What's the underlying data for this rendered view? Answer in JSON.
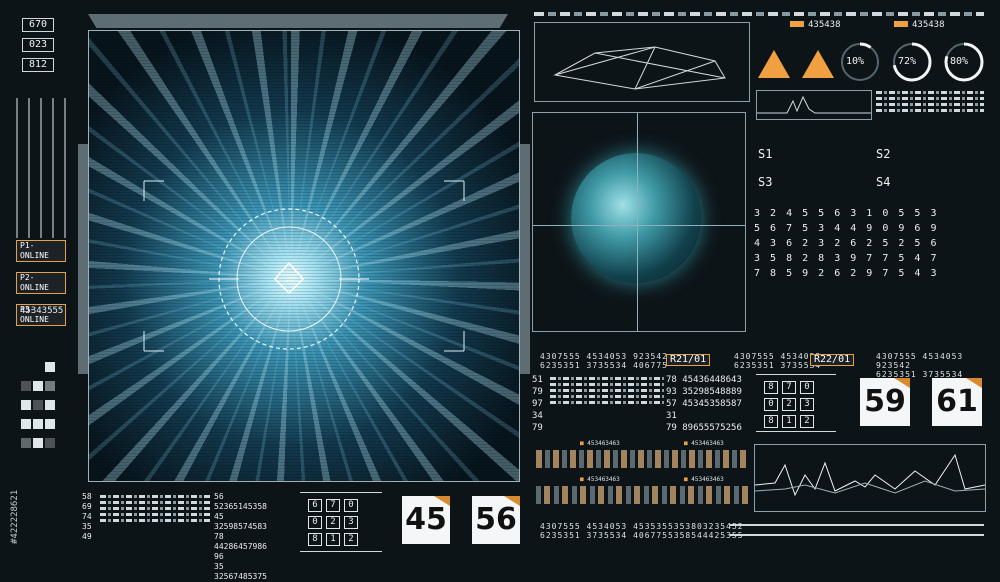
{
  "left_column": {
    "top_boxes": [
      "670",
      "023",
      "812"
    ],
    "status_labels": [
      "P1-ONLINE",
      "P2-ONLINE",
      "P3-ONLINE"
    ],
    "number": "45343555"
  },
  "watermark_id": "#422228621",
  "bottom_left_numbers": {
    "left": [
      "58",
      "69",
      "74",
      "35",
      "49"
    ],
    "mid_left": [
      "58",
      "45",
      "78",
      "96",
      "35"
    ],
    "mid_right": [
      "56 52365145358",
      "45 32598574583",
      "78 44286457986",
      "96 ",
      "35 32567485375"
    ]
  },
  "bottom_left_grid": [
    "6",
    "7",
    "0",
    "0",
    "2",
    "3",
    "8",
    "1",
    "2"
  ],
  "cards": {
    "c45": "45",
    "c56": "56",
    "c59": "59",
    "c61": "61"
  },
  "tags": {
    "r21": "R21/01",
    "r22": "R22/01"
  },
  "top_right": {
    "id1": "435438",
    "id2": "435438"
  },
  "gauges": [
    {
      "label": "10%",
      "value": 10
    },
    {
      "label": "72%",
      "value": 72
    },
    {
      "label": "80%",
      "value": 80
    }
  ],
  "s_labels": [
    "S1",
    "S2",
    "S3",
    "S4"
  ],
  "number_grid": [
    "3 2 4 5 5 6 3 1 0 5 5 3",
    "5 6 7 5 3 4 4 9 0 9 6 9",
    "4 3 6 2 3 2 6 2 5 2 5 6",
    "3 5 8 2 8 3 9 7 7 5 4 7",
    "7 8 5 9 2 6 2 9 7 5 4 3"
  ],
  "mid_right_block": {
    "left": [
      "51",
      "79",
      "97",
      "34",
      "79"
    ],
    "right": [
      "78 45436448643",
      "93 35298548889",
      "57 45345358587",
      "31 ",
      "79 89655575256"
    ]
  },
  "mid_grid": [
    "8",
    "7",
    "0",
    "0",
    "2",
    "3",
    "8",
    "1",
    "2"
  ],
  "header_nums": {
    "a": "4307555  4534053  923542",
    "b": "6235351  3735534  406775",
    "c": "4307555  4534053",
    "d": "6235351  3735534",
    "e": "4307555  4534053  923542",
    "f": "6235351  3735534  406775"
  },
  "bottom_mid_nums": {
    "a": "4307555  4534053  4535355353803235452",
    "b": "6235351  3735534  4067755358544425355"
  },
  "stripe_labels": [
    "453463463",
    "453463463",
    "453463463",
    "453463463"
  ],
  "colors": {
    "accent": "#f0a040",
    "frame": "#8aa0ad",
    "bg": "#0d1418"
  }
}
